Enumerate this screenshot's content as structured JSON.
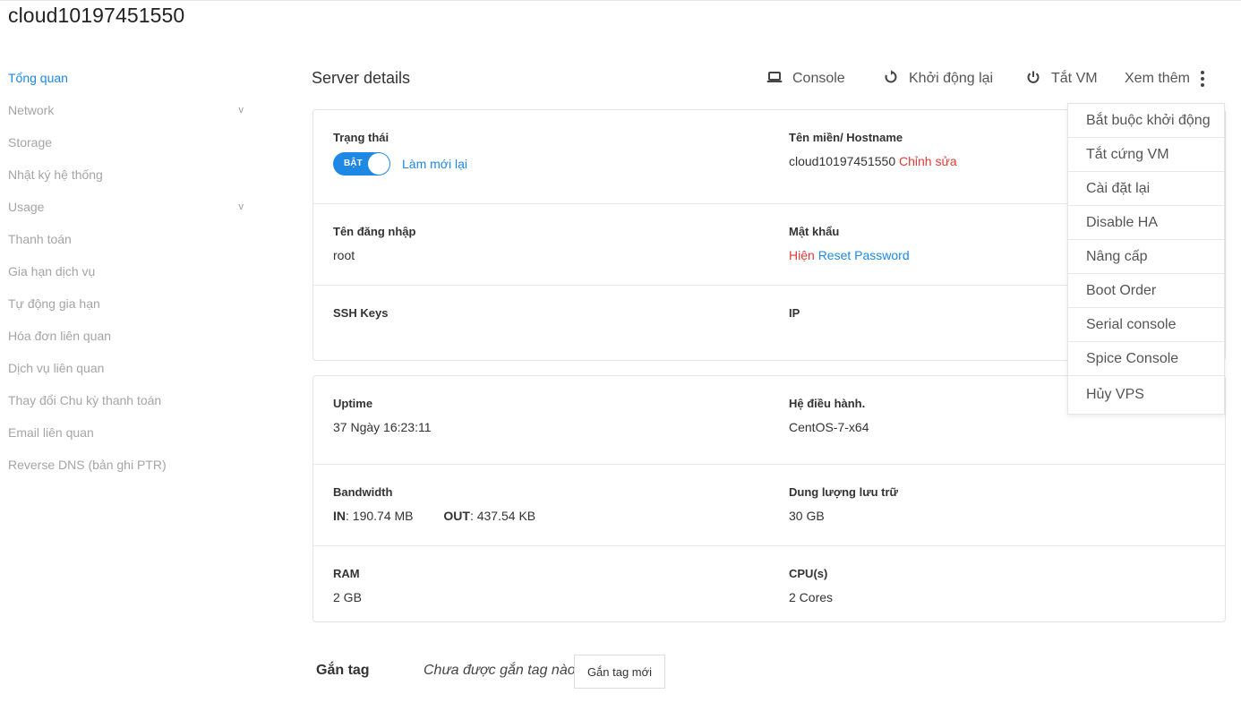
{
  "page": {
    "title": "cloud10197451550"
  },
  "sidebar": {
    "items": [
      {
        "label": "Tổng quan",
        "active": true,
        "has_caret": false
      },
      {
        "label": "Network",
        "active": false,
        "has_caret": true
      },
      {
        "label": "Storage",
        "active": false,
        "has_caret": false
      },
      {
        "label": "Nhật ký hệ thống",
        "active": false,
        "has_caret": false
      },
      {
        "label": "Usage",
        "active": false,
        "has_caret": true
      },
      {
        "label": "Thanh toán",
        "active": false,
        "has_caret": false
      },
      {
        "label": "Gia hạn dịch vụ",
        "active": false,
        "has_caret": false
      },
      {
        "label": "Tự động gia hạn",
        "active": false,
        "has_caret": false
      },
      {
        "label": "Hóa đơn liên quan",
        "active": false,
        "has_caret": false
      },
      {
        "label": "Dịch vụ liên quan",
        "active": false,
        "has_caret": false
      },
      {
        "label": "Thay đổi Chu kỳ thanh toán",
        "active": false,
        "has_caret": false
      },
      {
        "label": "Email liên quan",
        "active": false,
        "has_caret": false
      },
      {
        "label": "Reverse DNS (bản ghi PTR)",
        "active": false,
        "has_caret": false
      }
    ],
    "caret_glyph": "v"
  },
  "header": {
    "section_title": "Server details",
    "console_label": "Console",
    "console_icon": "laptop-icon",
    "restart_label": "Khởi động lại",
    "restart_icon": "refresh-icon",
    "shutdown_label": "Tắt VM",
    "shutdown_icon": "power-icon",
    "more_label": "Xem thêm",
    "more_icon": "kebab-menu-icon"
  },
  "details": {
    "status_label": "Trạng thái",
    "status_toggle_text": "BẬT",
    "status_on": true,
    "refresh_link": "Làm mới lại",
    "hostname_label": "Tên miền/ Hostname",
    "hostname_value": "cloud10197451550",
    "hostname_edit": "Chỉnh sửa",
    "username_label": "Tên đăng nhập",
    "username_value": "root",
    "password_label": "Mật khẩu",
    "password_show": "Hiện",
    "password_reset": "Reset Password",
    "ssh_label": "SSH Keys",
    "ip_label": "IP"
  },
  "stats": {
    "uptime_label": "Uptime",
    "uptime_value": "37 Ngày 16:23:11",
    "os_label": "Hệ điều hành.",
    "os_value": "CentOS-7-x64",
    "bandwidth_label": "Bandwidth",
    "bw_in_key": "IN",
    "bw_in_value": ": 190.74 MB",
    "bw_out_key": "OUT",
    "bw_out_value": ": 437.54 KB",
    "storage_label": "Dung lượng lưu trữ",
    "storage_value": "30 GB",
    "ram_label": "RAM",
    "ram_value": "2 GB",
    "cpu_label": "CPU(s)",
    "cpu_value": "2 Cores"
  },
  "dropdown": {
    "items": [
      "Bắt buộc khởi động",
      "Tắt cứng VM",
      "Cài đặt lại",
      "Disable HA",
      "Nâng cấp",
      "Boot Order",
      "Serial console",
      "Spice Console",
      "Hủy VPS"
    ]
  },
  "tags": {
    "label": "Gắn tag",
    "empty_text": "Chưa được gắn tag nào",
    "new_button": "Gắn tag mới"
  },
  "colors": {
    "accent": "#1e88e5",
    "danger": "#e53935",
    "muted": "#a5a5a5"
  }
}
